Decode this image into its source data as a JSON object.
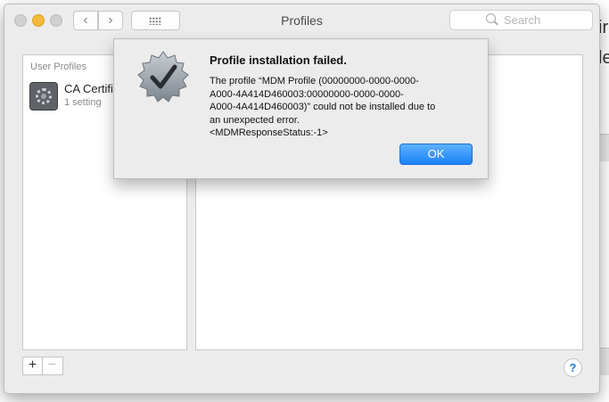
{
  "window": {
    "title": "Profiles",
    "search_placeholder": "Search"
  },
  "list": {
    "section_label": "User Profiles",
    "items": [
      {
        "name": "CA Certific",
        "subtitle": "1 setting"
      }
    ]
  },
  "bottom": {
    "add_label": "+",
    "remove_label": "−",
    "help_label": "?"
  },
  "alert": {
    "title": "Profile installation failed.",
    "message_lines": [
      "The profile “MDM Profile (00000000-0000-0000-",
      "A000-4A414D460003:00000000-0000-0000-",
      "A000-4A414D460003)” could not be installed due to",
      "an unexpected error.",
      "<MDMResponseStatus:-1>"
    ],
    "ok_label": "OK",
    "icon": "checkmark-badge-icon"
  },
  "background_app": {
    "line1": "ir",
    "line2": "le"
  },
  "colors": {
    "accent": "#1b82f7",
    "window_bg": "#ececec",
    "minimize": "#f5b93a"
  }
}
